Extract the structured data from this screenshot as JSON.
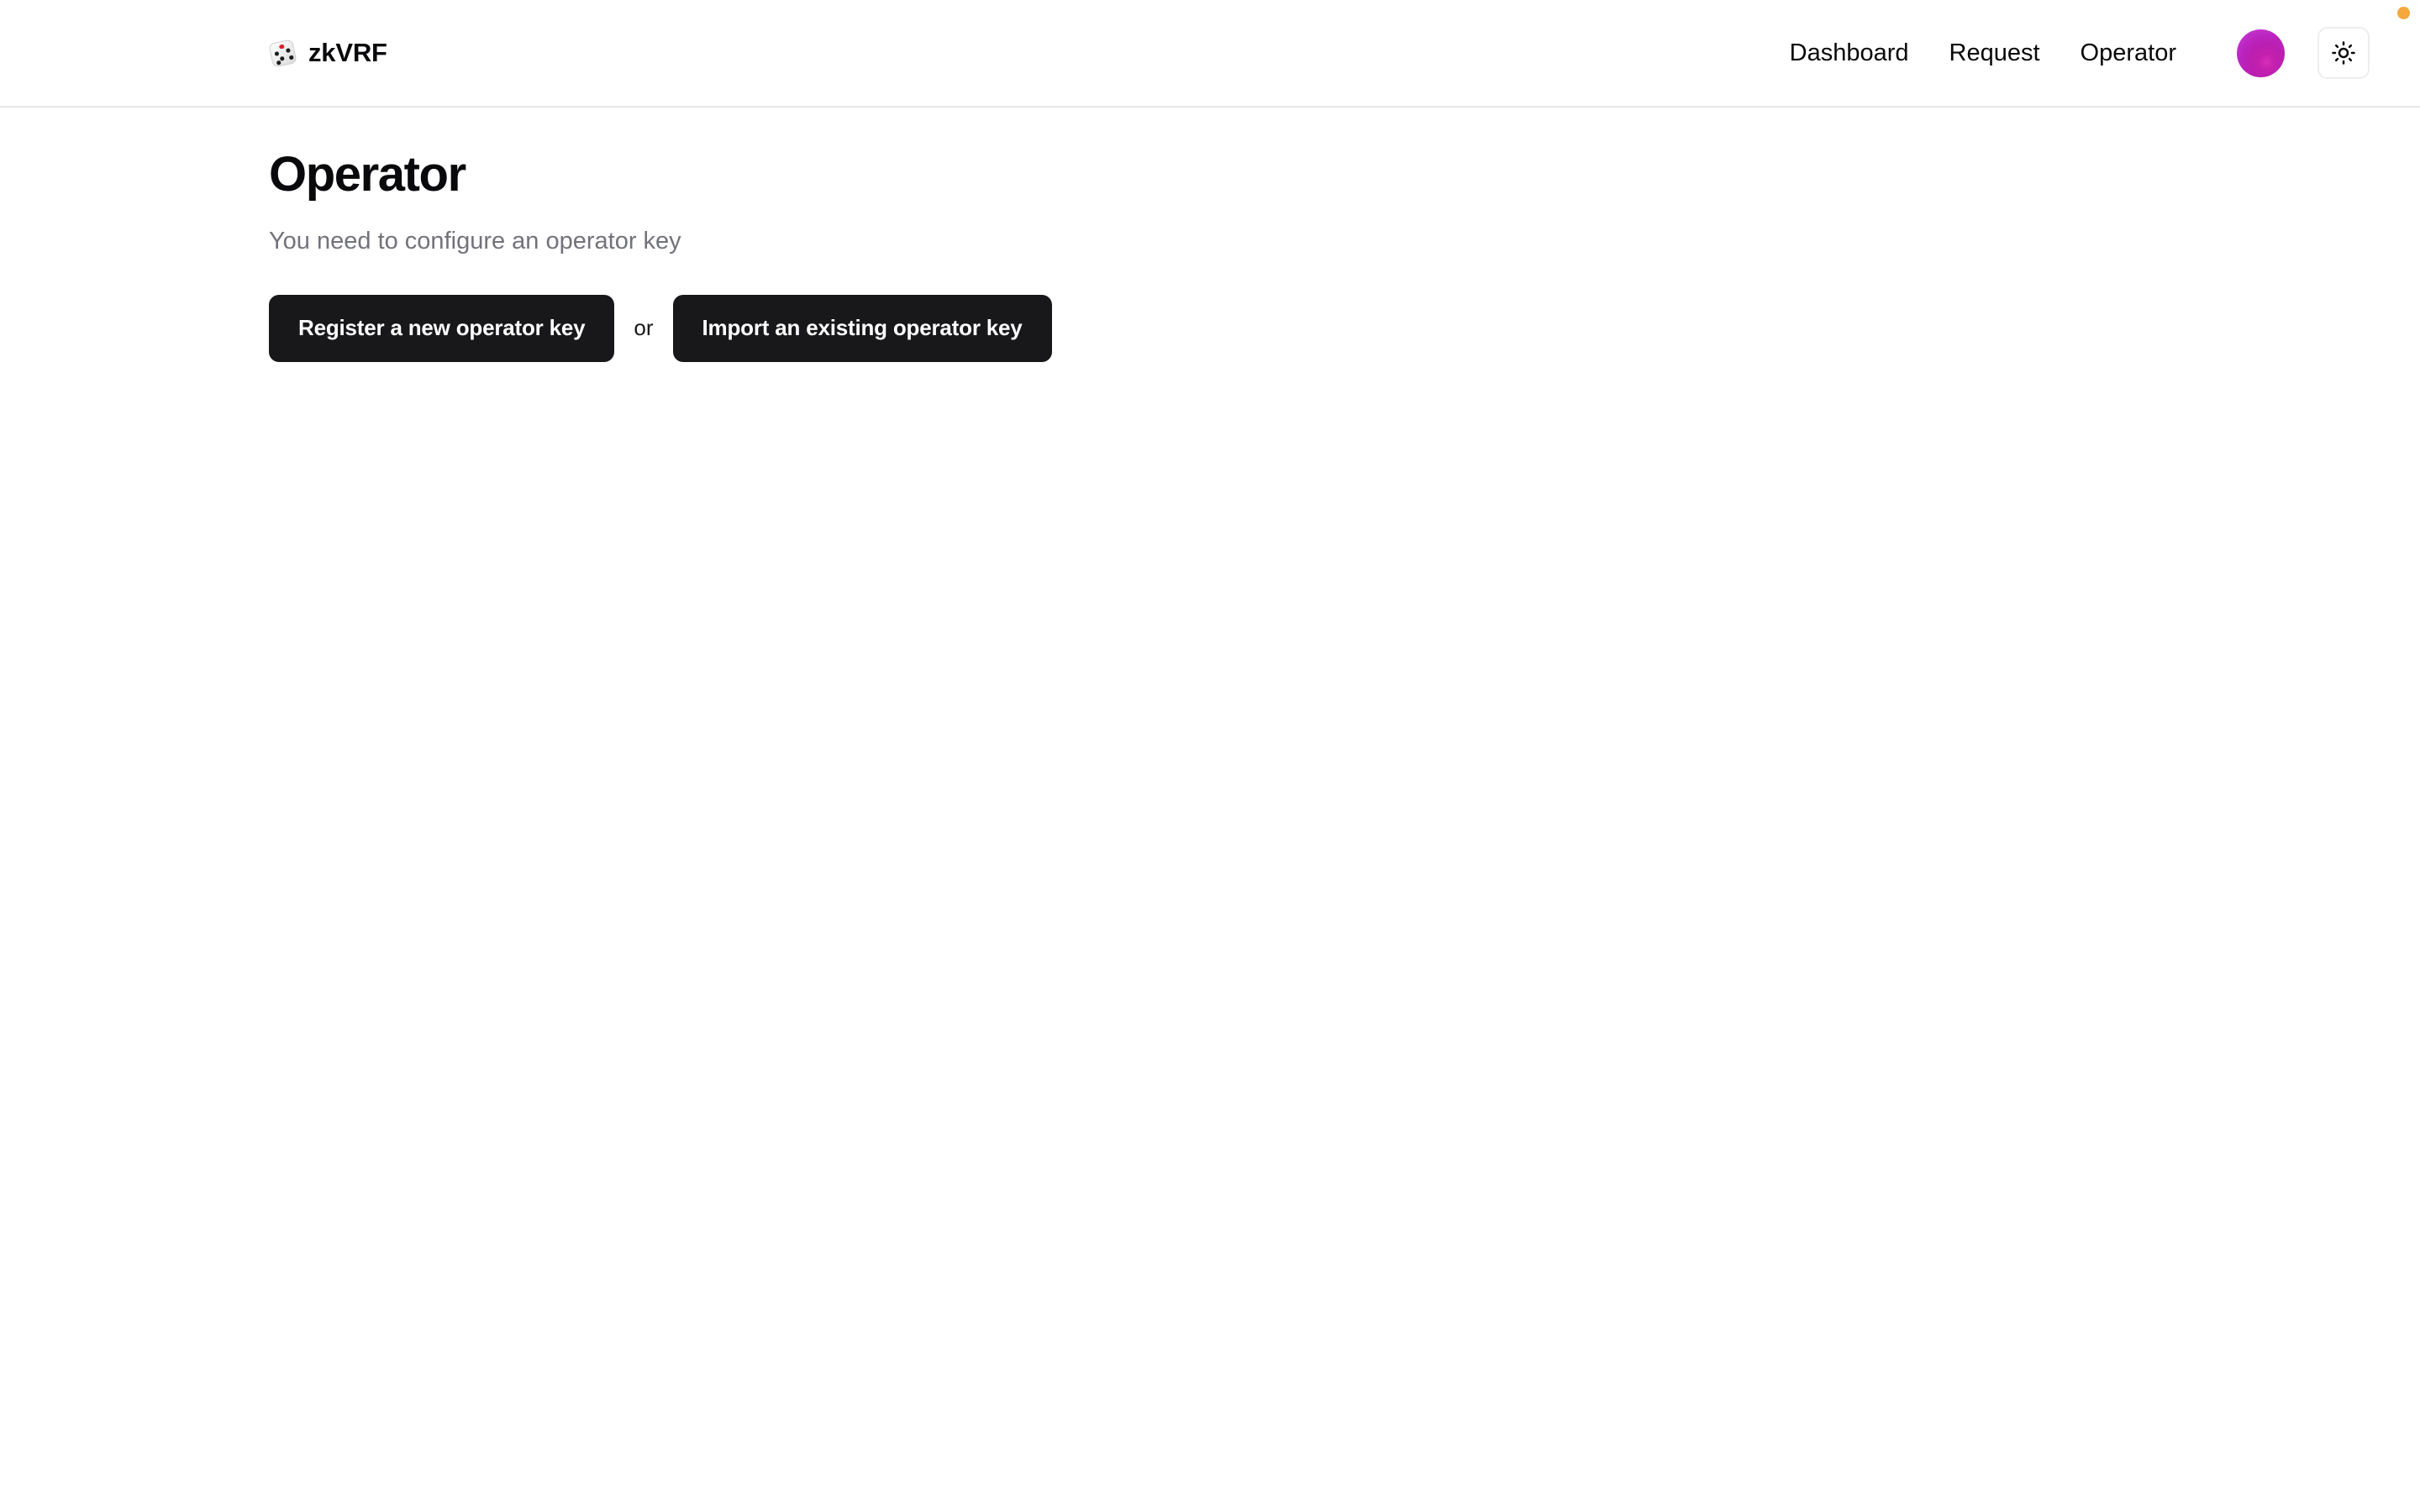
{
  "window": {
    "status_dot_color": "#f5a83c"
  },
  "header": {
    "brand": {
      "logo_icon": "dice-icon",
      "name": "zkVRF"
    },
    "nav": [
      {
        "label": "Dashboard",
        "name": "nav-link-dashboard"
      },
      {
        "label": "Request",
        "name": "nav-link-request"
      },
      {
        "label": "Operator",
        "name": "nav-link-operator"
      }
    ],
    "avatar": {
      "icon": "avatar-gradient",
      "colors": [
        "#e01fa9",
        "#c41fae",
        "#a818b8"
      ]
    },
    "theme_toggle": {
      "icon": "sun-icon",
      "label": "Toggle light mode"
    }
  },
  "main": {
    "title": "Operator",
    "subtitle": "You need to configure an operator key",
    "actions": {
      "primary_label": "Register a new operator key",
      "separator_label": "or",
      "secondary_label": "Import an existing operator key"
    }
  },
  "theme": {
    "background": "#ffffff",
    "foreground": "#09090b",
    "muted": "#72727b",
    "button": "#18181b",
    "border": "#e6e6e9"
  }
}
